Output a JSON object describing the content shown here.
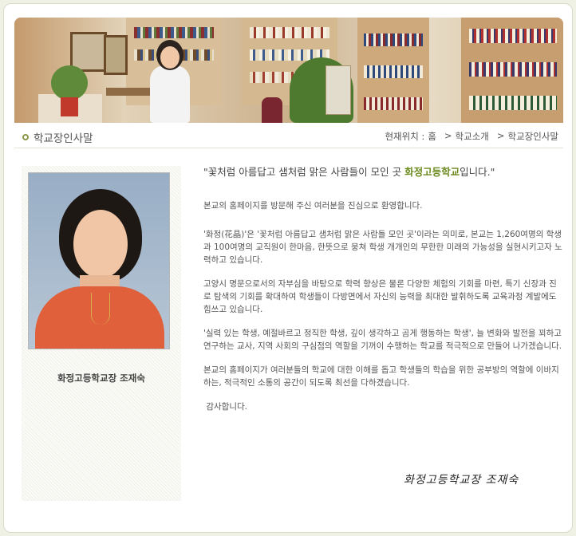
{
  "header": {
    "page_title": "학교장인사말",
    "location_label": "현재위치 :",
    "crumbs": [
      "홈",
      "학교소개",
      "학교장인사말"
    ],
    "separator": ">"
  },
  "profile": {
    "caption": "화정고등학교장  조재숙"
  },
  "content": {
    "headline_prefix": "\"꽃처럼 아름답고 샘처럼 맑은 사람들이 모인 곳 ",
    "headline_school": "화정고등학교",
    "headline_suffix": "입니다.\"",
    "paragraphs": [
      "본교의 홈페이지를 방문해 주신 여러분을 진심으로 환영합니다.",
      "'화정(花晶)'은 '꽃처럼 아름답고 샘처럼 맑은 사람들 모인 곳'이라는 의미로, 본교는 1,260여명의 학생과 100여명의 교직원이 한마음, 한뜻으로 뭉쳐 학생 개개인의 무한한 미래의 가능성을 실현시키고자 노력하고 있습니다.",
      "고양시 명문으로서의 자부심을 바탕으로 학력 향상은 물론 다양한 체험의 기회를 마련, 특기 신장과 진로 탐색의 기회를 확대하여 학생들이 다방면에서 자신의 능력을 최대한 발휘하도록 교육과정 계발에도 힘쓰고 있습니다.",
      "'실력 있는 학생, 예절바르고 정직한 학생, 깊이 생각하고 곰게 행동하는 학생', 늘 변화와 발전을 꾀하고 연구하는 교사, 지역 사회의 구심점의 역할을 기꺼이 수행하는 학교를 적극적으로 만들어 나가겠습니다.",
      "본교의 홈페이지가 여러분들의 학교에 대한 이해를 돕고 학생들의 학습을 위한 공부방의 역할에 이바지하는, 적극적인 소통의 공간이 되도록 최선을 다하겠습니다.",
      " 감사합니다."
    ],
    "signature": "화정고등학교장  조재숙"
  },
  "colors": {
    "accent": "#6c8a1e",
    "background": "#eef1e4"
  }
}
